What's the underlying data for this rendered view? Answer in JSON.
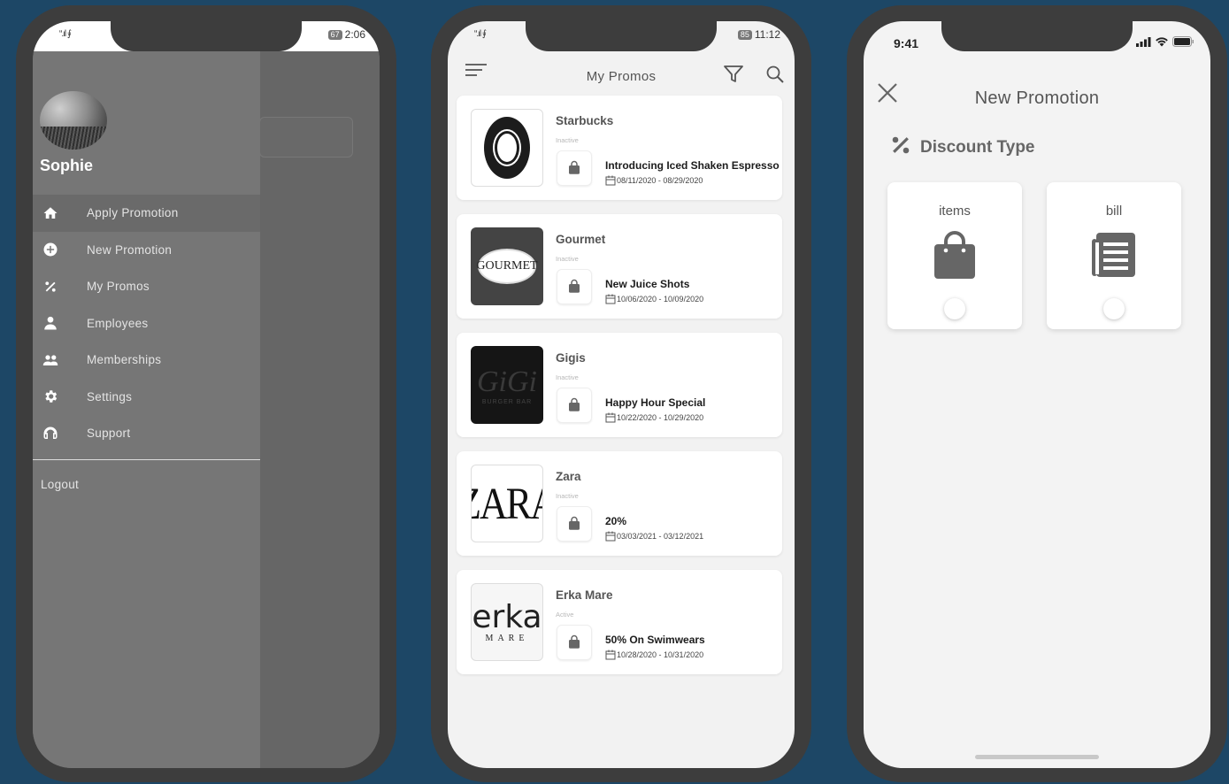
{
  "phone1": {
    "status": {
      "signal": "“.ıl ⨚",
      "battery": "67",
      "time": "2:06"
    },
    "user_name": "Sophie",
    "menu": [
      {
        "label": "Apply Promotion",
        "icon": "home-icon",
        "active": true
      },
      {
        "label": "New Promotion",
        "icon": "plus-circle-icon"
      },
      {
        "label": "My Promos",
        "icon": "percent-icon"
      },
      {
        "label": "Employees",
        "icon": "employee-icon"
      },
      {
        "label": "Memberships",
        "icon": "group-icon"
      },
      {
        "label": "Settings",
        "icon": "gear-icon"
      },
      {
        "label": "Support",
        "icon": "headset-icon"
      }
    ],
    "logout": "Logout"
  },
  "phone2": {
    "status": {
      "signal": "“.ıl ⨚",
      "battery": "85",
      "time": "11:12"
    },
    "title": "My Promos",
    "promos": [
      {
        "brand": "Starbucks",
        "status": "Inactive",
        "title": "Introducing Iced Shaken Espresso",
        "dates": "08/11/2020 - 08/29/2020"
      },
      {
        "brand": "Gourmet",
        "status": "Inactive",
        "title": "New Juice Shots",
        "dates": "10/06/2020 - 10/09/2020",
        "logo_text": "GOURMET"
      },
      {
        "brand": "Gigis",
        "status": "Inactive",
        "title": "Happy Hour Special",
        "dates": "10/22/2020 - 10/29/2020",
        "logo_text": "GiGi",
        "logo_sub": "BURGER BAR"
      },
      {
        "brand": "Zara",
        "status": "Inactive",
        "title": "20%",
        "dates": "03/03/2021 - 03/12/2021",
        "logo_text": "ZARA"
      },
      {
        "brand": "Erka Mare",
        "status": "Active",
        "title": "50% On Swimwears",
        "dates": "10/28/2020 - 10/31/2020",
        "logo_text": "erka",
        "logo_sub": "MARE"
      }
    ]
  },
  "phone3": {
    "status": {
      "time": "9:41"
    },
    "title": "New Promotion",
    "section_label": "Discount Type",
    "options": [
      {
        "label": "items",
        "icon": "shopping-bag-icon",
        "selected": false
      },
      {
        "label": "bill",
        "icon": "receipt-icon",
        "selected": false
      }
    ]
  }
}
